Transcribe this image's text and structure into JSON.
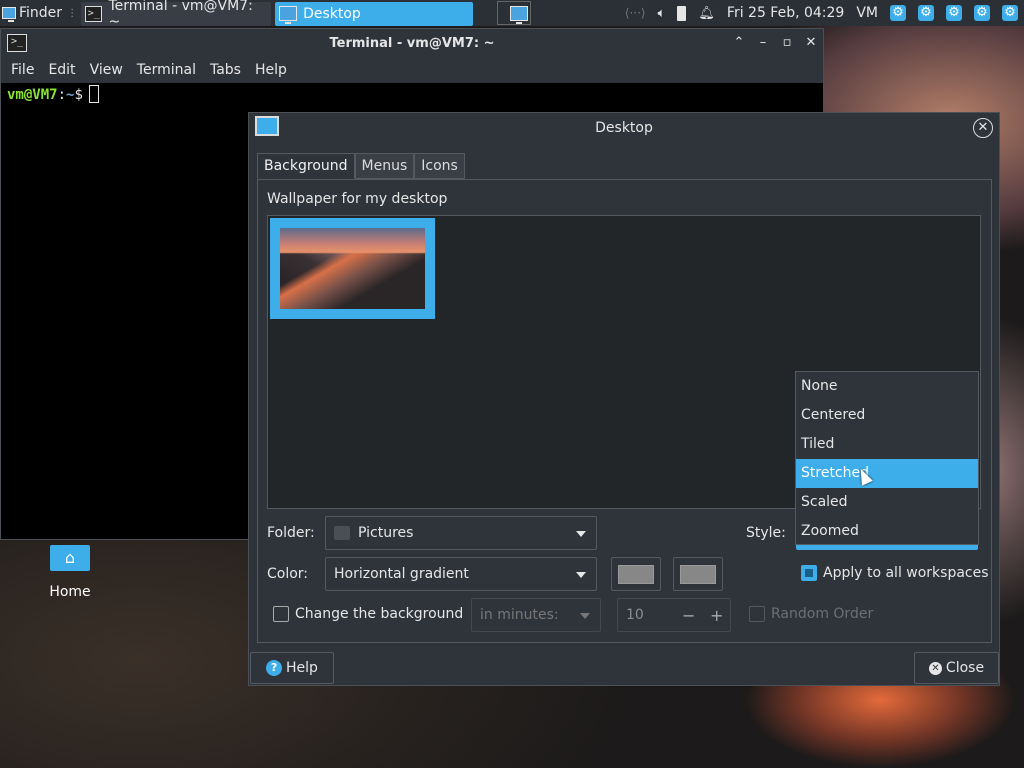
{
  "top_panel": {
    "finder_label": "Finder",
    "tasks": [
      {
        "label": "Terminal - vm@VM7: ~"
      },
      {
        "label": "Desktop"
      }
    ],
    "clock": "Fri 25 Feb, 04:29",
    "user": "VM",
    "gears": [
      "⚙",
      "⚙",
      "⚙",
      "⚙",
      "⚙"
    ]
  },
  "terminal": {
    "title": "Terminal - vm@VM7: ~",
    "menu": [
      "File",
      "Edit",
      "View",
      "Terminal",
      "Tabs",
      "Help"
    ],
    "prompt_user": "vm@VM7",
    "prompt_sep": ":",
    "prompt_path": "~",
    "prompt_end": "$"
  },
  "desktop_icon": {
    "label": "Home"
  },
  "dialog": {
    "title": "Desktop",
    "tabs": [
      "Background",
      "Menus",
      "Icons"
    ],
    "active_tab": "Background",
    "wallpaper_caption": "Wallpaper for my desktop",
    "folder_label": "Folder:",
    "folder_value": "Pictures",
    "style_label": "Style:",
    "color_label": "Color:",
    "color_value": "Horizontal gradient",
    "apply_all_label": "Apply to all workspaces",
    "change_bg_label": "Change the background",
    "interval_value": "in minutes:",
    "interval_number": "10",
    "random_order_label": "Random Order",
    "help_label": "Help",
    "close_label": "Close",
    "style_options": [
      "None",
      "Centered",
      "Tiled",
      "Stretched",
      "Scaled",
      "Zoomed"
    ],
    "style_selected": "Stretched"
  },
  "colors": {
    "accent": "#3daee9",
    "panel_bg": "#2f343b",
    "swatch": "#878787"
  }
}
